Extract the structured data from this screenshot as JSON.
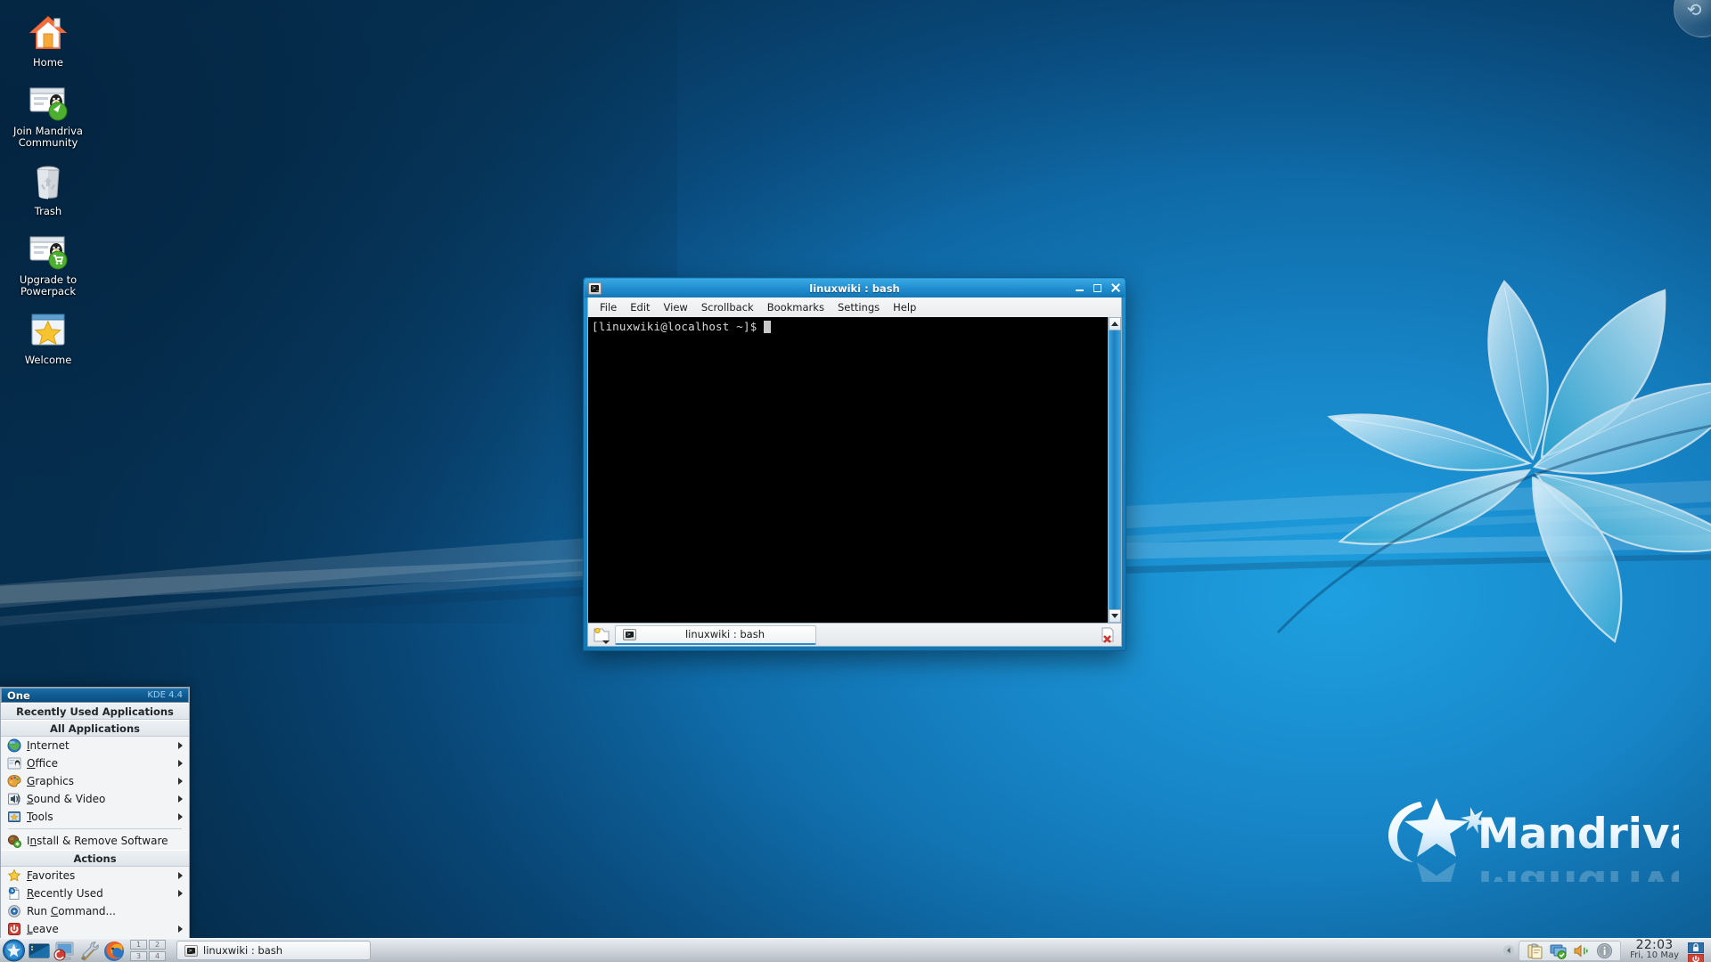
{
  "desktop": {
    "icons": [
      {
        "label": "Home",
        "icon": "home-folder-icon"
      },
      {
        "label": "Join Mandriva Community",
        "icon": "mandriva-community-icon"
      },
      {
        "label": "Trash",
        "icon": "trash-icon"
      },
      {
        "label": "Upgrade to Powerpack",
        "icon": "upgrade-powerpack-icon"
      },
      {
        "label": "Welcome",
        "icon": "welcome-star-icon"
      }
    ],
    "brand": "Mandriva",
    "toolbox": "plasma-cashew-icon",
    "colors": {
      "wallpaper_light": "#1ea0e0",
      "wallpaper_dark": "#07395f",
      "accent": "#2193d3"
    }
  },
  "konsole": {
    "title": "linuxwiki : bash",
    "window_icon": "terminal-icon",
    "buttons": {
      "minimize": "Minimize",
      "maximize": "Maximize",
      "close": "Close"
    },
    "menu": [
      "File",
      "Edit",
      "View",
      "Scrollback",
      "Bookmarks",
      "Settings",
      "Help"
    ],
    "terminal_lines": [
      "[linuxwiki@localhost ~]$ "
    ],
    "tab": {
      "label": "linuxwiki : bash",
      "new_tab": "New Tab",
      "close_tab": "Close Tab"
    },
    "scrollbar": {
      "up": "scroll-up",
      "down": "scroll-down"
    }
  },
  "kmenu": {
    "title": "One",
    "version": "KDE 4.4",
    "sections": {
      "recent": "Recently Used Applications",
      "all": "All Applications",
      "actions": "Actions"
    },
    "applications": [
      {
        "label": "Internet",
        "accel": "I",
        "icon": "globe-icon",
        "submenu": true
      },
      {
        "label": "Office",
        "accel": "O",
        "icon": "office-icon",
        "submenu": true
      },
      {
        "label": "Graphics",
        "accel": "G",
        "icon": "palette-icon",
        "submenu": true
      },
      {
        "label": "Sound & Video",
        "accel": "S",
        "icon": "speaker-icon",
        "submenu": true
      },
      {
        "label": "Tools",
        "accel": "T",
        "icon": "tools-star-icon",
        "submenu": true
      }
    ],
    "software": {
      "label": "Install & Remove Software",
      "accel": "n",
      "icon": "package-icon",
      "submenu": false
    },
    "actions": [
      {
        "label": "Favorites",
        "accel": "F",
        "icon": "star-icon",
        "submenu": true
      },
      {
        "label": "Recently Used",
        "accel": "R",
        "icon": "recent-document-icon",
        "submenu": true
      },
      {
        "label": "Run Command...",
        "accel": "C",
        "icon": "run-command-icon",
        "submenu": false
      },
      {
        "label": "Leave",
        "accel": "L",
        "icon": "power-icon",
        "submenu": true
      }
    ]
  },
  "panel": {
    "kbutton": "kde-menu-button",
    "launchers": [
      {
        "name": "show-desktop-icon",
        "title": "Show Desktop"
      },
      {
        "name": "mandriva-control-center-icon",
        "title": "Configure Your Computer"
      },
      {
        "name": "system-tools-icon",
        "title": "System Tools"
      },
      {
        "name": "firefox-icon",
        "title": "Firefox"
      }
    ],
    "pager": [
      "1",
      "2",
      "3",
      "4"
    ],
    "tasks": [
      {
        "label": "linuxwiki : bash",
        "icon": "terminal-icon",
        "active": true
      }
    ],
    "tray": {
      "expander": "tray-expand-arrow",
      "items": [
        {
          "name": "klipper-clipboard-icon",
          "title": "Klipper"
        },
        {
          "name": "display-configuration-icon",
          "title": "Display"
        },
        {
          "name": "volume-icon",
          "title": "Volume"
        },
        {
          "name": "notifications-info-icon",
          "title": "Notifications"
        }
      ]
    },
    "clock": {
      "time": "22:03",
      "date": "Fri, 10 May"
    },
    "right_buttons": [
      {
        "name": "lock-screen-icon",
        "title": "Lock Screen"
      },
      {
        "name": "logout-icon",
        "title": "Leave"
      }
    ]
  }
}
